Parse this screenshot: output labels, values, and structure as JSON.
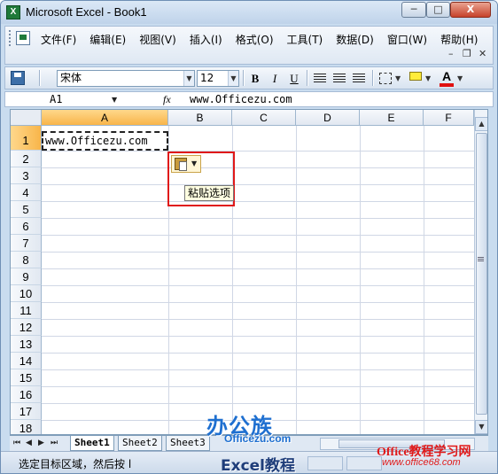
{
  "window": {
    "title": "Microsoft Excel - Book1",
    "app_icon": "X",
    "min_glyph": "─",
    "max_glyph": "□",
    "close_glyph": "X"
  },
  "menu": {
    "items": [
      "文件(F)",
      "编辑(E)",
      "视图(V)",
      "插入(I)",
      "格式(O)",
      "工具(T)",
      "数据(D)",
      "窗口(W)",
      "帮助(H)"
    ],
    "mdi_restore": "❐",
    "mdi_close": "✕",
    "mdi_minimize": "–"
  },
  "toolbar": {
    "font_name": "宋体",
    "font_size": "12",
    "bold": "B",
    "italic": "I",
    "underline": "U",
    "font_color_glyph": "A",
    "font_color": "#e01010",
    "fill_color": "#ffec3b"
  },
  "formula_bar": {
    "name_box": "A1",
    "fx": "fx",
    "content": "www.Officezu.com"
  },
  "grid": {
    "columns": [
      "A",
      "B",
      "C",
      "D",
      "E",
      "F"
    ],
    "active_column": "A",
    "rows": [
      "1",
      "2",
      "3",
      "4",
      "5",
      "6",
      "7",
      "8",
      "9",
      "10",
      "11",
      "12",
      "13",
      "14",
      "15",
      "16",
      "17",
      "18"
    ],
    "active_row": "1",
    "cell_a1": "www.Officezu.com"
  },
  "paste_options": {
    "tooltip": "粘贴选项",
    "highlight_color": "#e01919"
  },
  "sheets": {
    "tabs": [
      "Sheet1",
      "Sheet2",
      "Sheet3"
    ],
    "active": "Sheet1",
    "nav": [
      "⏮",
      "◀",
      "▶",
      "⏭"
    ]
  },
  "status": {
    "text": "选定目标区域，然后按 l"
  },
  "watermarks": {
    "brand": "办公族",
    "brand_url": "Officezu.com",
    "excel": "Excel教程",
    "office": "Office教程学习网",
    "office_url": "www.office68.com"
  }
}
